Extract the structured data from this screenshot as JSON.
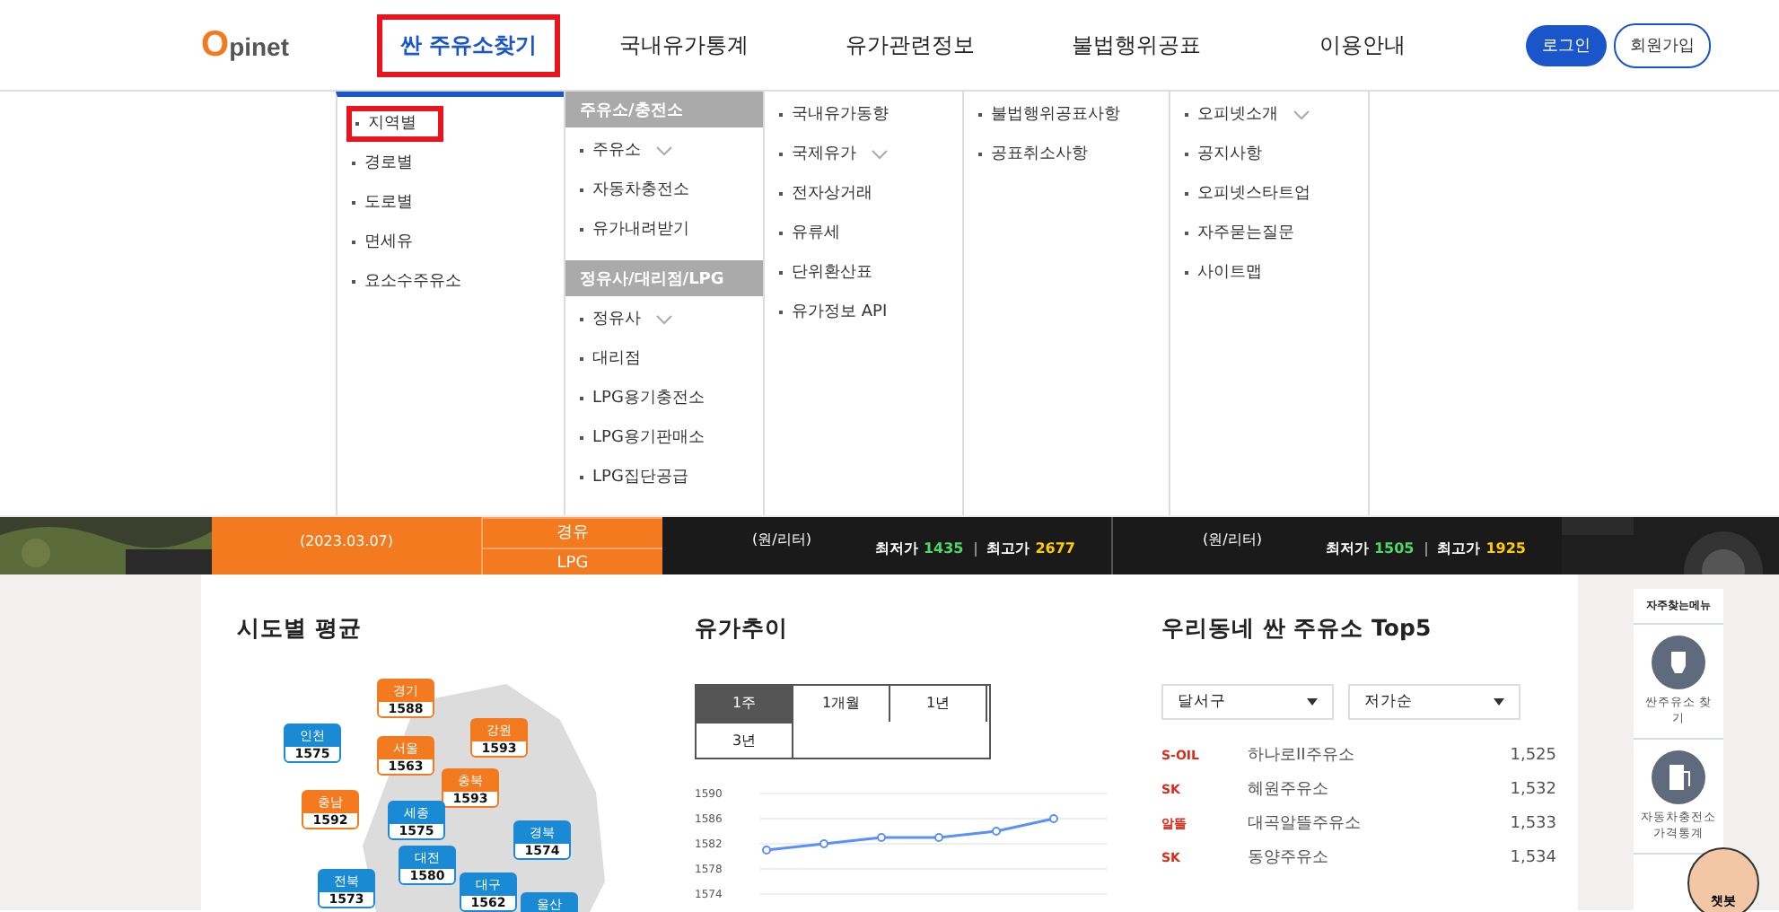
{
  "header": {
    "logo": "Opinet",
    "nav": [
      {
        "label": "싼 주유소찾기",
        "selected": true
      },
      {
        "label": "국내유가통계",
        "selected": false
      },
      {
        "label": "유가관련정보",
        "selected": false
      },
      {
        "label": "불법행위공표",
        "selected": false
      },
      {
        "label": "이용안내",
        "selected": false
      }
    ],
    "login": "로그인",
    "signup": "회원가입"
  },
  "dropdown": {
    "columns": [
      {
        "sections": [
          {
            "items": [
              {
                "label": "지역별",
                "selected": true,
                "expandable": false
              },
              {
                "label": "경로별",
                "selected": false,
                "expandable": false
              },
              {
                "label": "도로별",
                "selected": false,
                "expandable": false
              },
              {
                "label": "면세유",
                "selected": false,
                "expandable": false
              },
              {
                "label": "요소수주유소",
                "selected": false,
                "expandable": false
              }
            ]
          }
        ]
      },
      {
        "sections": [
          {
            "heading": "주유소/충전소",
            "items": [
              {
                "label": "주유소",
                "selected": false,
                "expandable": true
              },
              {
                "label": "자동차충전소",
                "selected": false,
                "expandable": false
              },
              {
                "label": "유가내려받기",
                "selected": false,
                "expandable": false
              }
            ]
          },
          {
            "heading": "정유사/대리점/LPG",
            "items": [
              {
                "label": "정유사",
                "selected": false,
                "expandable": true
              },
              {
                "label": "대리점",
                "selected": false,
                "expandable": false
              },
              {
                "label": "LPG용기충전소",
                "selected": false,
                "expandable": false
              },
              {
                "label": "LPG용기판매소",
                "selected": false,
                "expandable": false
              },
              {
                "label": "LPG집단공급",
                "selected": false,
                "expandable": false
              }
            ]
          }
        ]
      },
      {
        "sections": [
          {
            "items": [
              {
                "label": "국내유가동향",
                "selected": false,
                "expandable": false
              },
              {
                "label": "국제유가",
                "selected": false,
                "expandable": true
              },
              {
                "label": "전자상거래",
                "selected": false,
                "expandable": false
              },
              {
                "label": "유류세",
                "selected": false,
                "expandable": false
              },
              {
                "label": "단위환산표",
                "selected": false,
                "expandable": false
              },
              {
                "label": "유가정보 API",
                "selected": false,
                "expandable": false
              }
            ]
          }
        ]
      },
      {
        "sections": [
          {
            "items": [
              {
                "label": "불법행위공표사항",
                "selected": false,
                "expandable": false
              },
              {
                "label": "공표취소사항",
                "selected": false,
                "expandable": false
              }
            ]
          }
        ]
      },
      {
        "sections": [
          {
            "items": [
              {
                "label": "오피넷소개",
                "selected": false,
                "expandable": true
              },
              {
                "label": "공지사항",
                "selected": false,
                "expandable": false
              },
              {
                "label": "오피넷스타트업",
                "selected": false,
                "expandable": false
              },
              {
                "label": "자주묻는질문",
                "selected": false,
                "expandable": false
              },
              {
                "label": "사이트맵",
                "selected": false,
                "expandable": false
              }
            ]
          }
        ]
      }
    ]
  },
  "price_bar": {
    "date": "(2023.03.07)",
    "fuels": [
      "경유",
      "LPG"
    ],
    "blocks": [
      {
        "unit": "(원/리터)",
        "low_label": "최저가",
        "low": "1435",
        "high_label": "최고가",
        "high": "2677"
      },
      {
        "unit": "(원/리터)",
        "low_label": "최저가",
        "low": "1505",
        "high_label": "최고가",
        "high": "1925"
      }
    ]
  },
  "regional": {
    "title": "시도별 평균",
    "regions": [
      {
        "name": "경기",
        "price": "1588",
        "color": "#f47a1f"
      },
      {
        "name": "인천",
        "price": "1575",
        "color": "#1a8ad4"
      },
      {
        "name": "서울",
        "price": "1563",
        "color": "#f47a1f"
      },
      {
        "name": "강원",
        "price": "1593",
        "color": "#f47a1f"
      },
      {
        "name": "충북",
        "price": "1593",
        "color": "#f47a1f"
      },
      {
        "name": "충남",
        "price": "1592",
        "color": "#f47a1f"
      },
      {
        "name": "세종",
        "price": "1575",
        "color": "#1a8ad4"
      },
      {
        "name": "경북",
        "price": "1574",
        "color": "#1a8ad4"
      },
      {
        "name": "대전",
        "price": "1580",
        "color": "#1a8ad4"
      },
      {
        "name": "전북",
        "price": "1573",
        "color": "#1a8ad4"
      },
      {
        "name": "대구",
        "price": "1562",
        "color": "#1a8ad4"
      },
      {
        "name": "울산",
        "color": "#1a8ad4"
      }
    ]
  },
  "trend": {
    "title": "유가추이",
    "tabs": [
      {
        "label": "1주",
        "selected": true
      },
      {
        "label": "1개월",
        "selected": false
      },
      {
        "label": "1년",
        "selected": false
      },
      {
        "label": "3년",
        "selected": false
      }
    ],
    "chart_data": {
      "type": "line",
      "ylim": [
        1574,
        1590
      ],
      "grid": true,
      "yticks": [
        1574,
        1578,
        1582,
        1586,
        1590
      ],
      "series": [
        {
          "color": "#5b8ff9",
          "marker": true,
          "values": [
            1581,
            1582,
            1583,
            1583,
            1584,
            1586
          ]
        }
      ]
    }
  },
  "top5": {
    "title": "우리동네 싼 주유소 Top5",
    "district": "달서구",
    "sort": "저가순",
    "rows": [
      {
        "brand": "S-OIL",
        "name": "하나로II주유소",
        "price": "1,525"
      },
      {
        "brand": "SK",
        "name": "혜원주유소",
        "price": "1,532"
      },
      {
        "brand": "알뜰",
        "name": "대곡알뜰주유소",
        "price": "1,533"
      },
      {
        "brand": "SK",
        "name": "동양주유소",
        "price": "1,534"
      }
    ]
  },
  "quick_menu": {
    "title": "자주찾는메뉴",
    "items": [
      {
        "label": "싼주유소 찾기",
        "kind": "bulb"
      },
      {
        "label": "자동차충전소 가격통계",
        "kind": "pump"
      }
    ]
  },
  "chatbot": {
    "label": "챗봇"
  }
}
